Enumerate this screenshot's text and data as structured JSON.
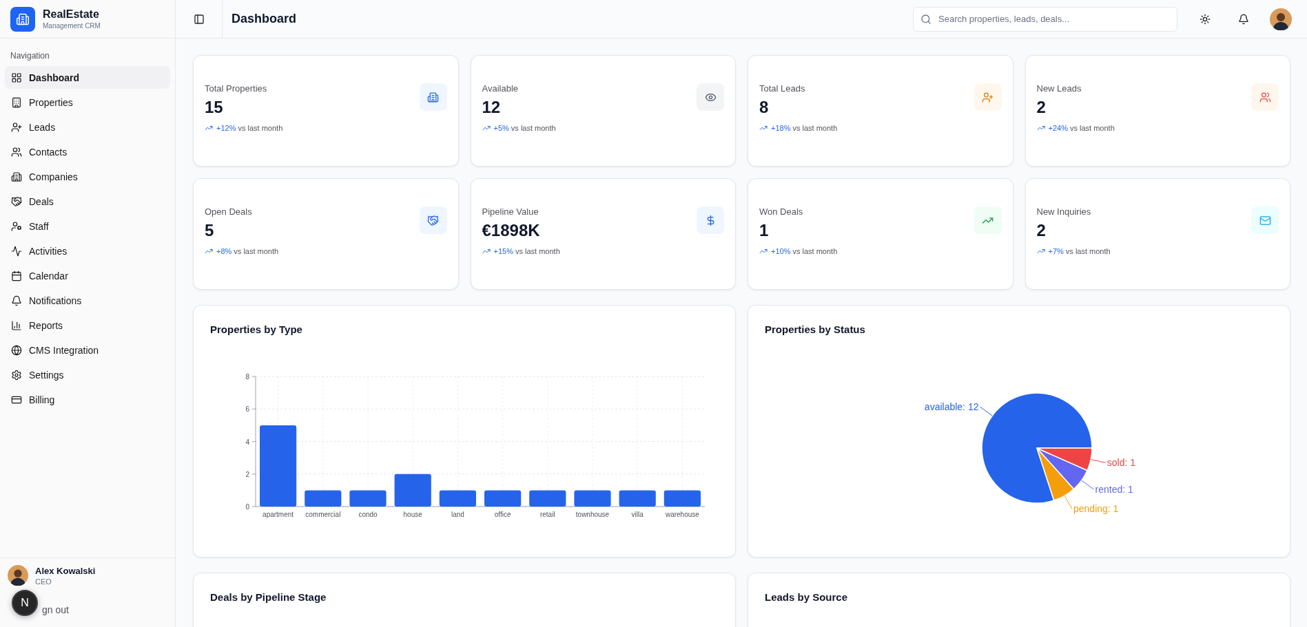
{
  "brand": {
    "name": "RealEstate",
    "subtitle": "Management CRM"
  },
  "sidebar": {
    "section": "Navigation",
    "items": [
      {
        "label": "Dashboard",
        "selected": true
      },
      {
        "label": "Properties",
        "selected": false
      },
      {
        "label": "Leads",
        "selected": false
      },
      {
        "label": "Contacts",
        "selected": false
      },
      {
        "label": "Companies",
        "selected": false
      },
      {
        "label": "Deals",
        "selected": false
      },
      {
        "label": "Staff",
        "selected": false
      },
      {
        "label": "Activities",
        "selected": false
      },
      {
        "label": "Calendar",
        "selected": false
      },
      {
        "label": "Notifications",
        "selected": false
      },
      {
        "label": "Reports",
        "selected": false
      },
      {
        "label": "CMS Integration",
        "selected": false
      },
      {
        "label": "Settings",
        "selected": false
      },
      {
        "label": "Billing",
        "selected": false
      }
    ],
    "user": {
      "name": "Alex Kowalski",
      "role": "CEO"
    },
    "signout": "gn out",
    "badge": "N"
  },
  "header": {
    "title": "Dashboard",
    "search": {
      "placeholder": "Search properties, leads, deals..."
    }
  },
  "stats": [
    {
      "label": "Total Properties",
      "value": "15",
      "change": "+12%",
      "note": "vs last month"
    },
    {
      "label": "Available",
      "value": "12",
      "change": "+5%",
      "note": "vs last month"
    },
    {
      "label": "Total Leads",
      "value": "8",
      "change": "+18%",
      "note": "vs last month"
    },
    {
      "label": "New Leads",
      "value": "2",
      "change": "+24%",
      "note": "vs last month"
    },
    {
      "label": "Open Deals",
      "value": "5",
      "change": "+8%",
      "note": "vs last month"
    },
    {
      "label": "Pipeline Value",
      "value": "€1898K",
      "change": "+15%",
      "note": "vs last month"
    },
    {
      "label": "Won Deals",
      "value": "1",
      "change": "+10%",
      "note": "vs last month"
    },
    {
      "label": "New Inquiries",
      "value": "2",
      "change": "+7%",
      "note": "vs last month"
    }
  ],
  "charts": [
    {
      "title": "Properties by Type",
      "chart_data": {
        "type": "bar",
        "categories": [
          "apartment",
          "commercial",
          "condo",
          "house",
          "land",
          "office",
          "retail",
          "townhouse",
          "villa",
          "warehouse"
        ],
        "values": [
          5,
          1,
          1,
          2,
          1,
          1,
          1,
          1,
          1,
          1
        ],
        "ylim": [
          0,
          8
        ],
        "yticks": [
          0,
          2,
          4,
          6,
          8
        ],
        "grid": true
      }
    },
    {
      "title": "Properties by Status",
      "chart_data": {
        "type": "pie",
        "categories": [
          "available: 12",
          "pending: 1",
          "rented: 1",
          "sold: 1"
        ],
        "values": [
          12,
          1,
          1,
          1
        ],
        "colors": [
          "#2563eb",
          "#f59e0b",
          "#6366f1",
          "#ef4444"
        ]
      }
    }
  ],
  "lower_cards": [
    {
      "title": "Deals by Pipeline Stage"
    },
    {
      "title": "Leads by Source"
    }
  ]
}
